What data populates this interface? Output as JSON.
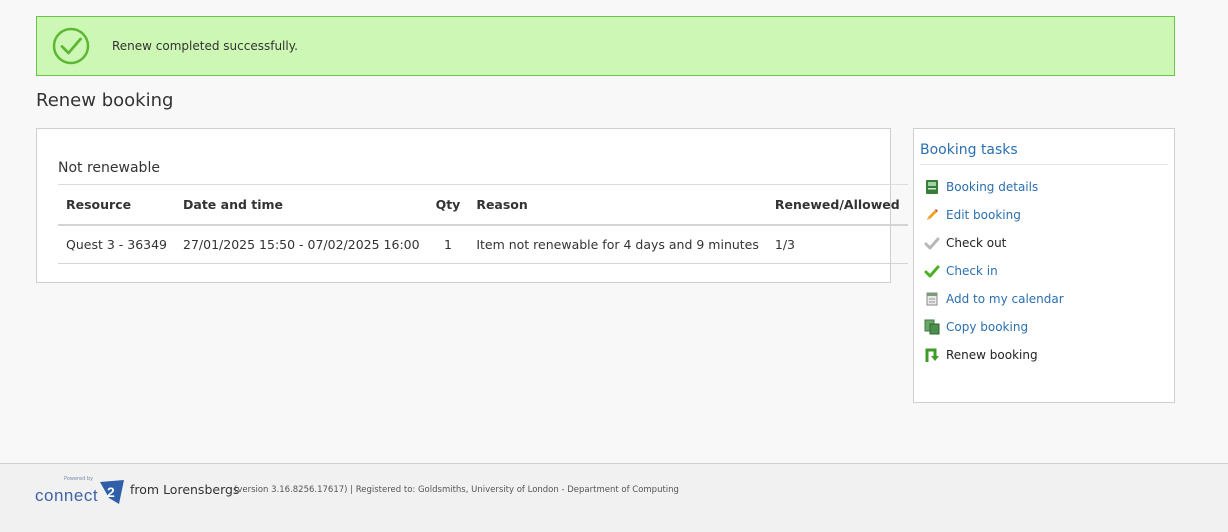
{
  "alert": {
    "message": "Renew completed successfully.",
    "icon": "check-circle-icon",
    "color": "#cdf7b4"
  },
  "page_title": "Renew booking",
  "panel": {
    "title": "Not renewable",
    "columns": [
      "Resource",
      "Date and time",
      "Qty",
      "Reason",
      "Renewed/Allowed"
    ],
    "rows": [
      {
        "resource": "Quest 3 - 36349",
        "datetime": "27/01/2025 15:50 - 07/02/2025 16:00",
        "qty": "1",
        "reason": "Item not renewable for 4 days and 9 minutes",
        "renewed": "1/3"
      }
    ]
  },
  "tasks": {
    "title": "Booking tasks",
    "items": [
      {
        "label": "Booking details",
        "icon": "book-icon"
      },
      {
        "label": "Edit booking",
        "icon": "pencil-icon"
      },
      {
        "label": "Check out",
        "icon": "checkmark-grey-icon"
      },
      {
        "label": "Check in",
        "icon": "checkmark-green-icon"
      },
      {
        "label": "Add to my calendar",
        "icon": "calendar-icon"
      },
      {
        "label": "Copy booking",
        "icon": "copy-icon"
      },
      {
        "label": "Renew booking",
        "icon": "renew-arrow-icon"
      }
    ]
  },
  "footer": {
    "logo_powered": "Powered by",
    "logo_text": "connect",
    "logo_badge": "2",
    "from": "from Lorensbergs",
    "meta": "(version 3.16.8256.17617) | Registered to: Goldsmiths, University of London - Department of Computing"
  }
}
